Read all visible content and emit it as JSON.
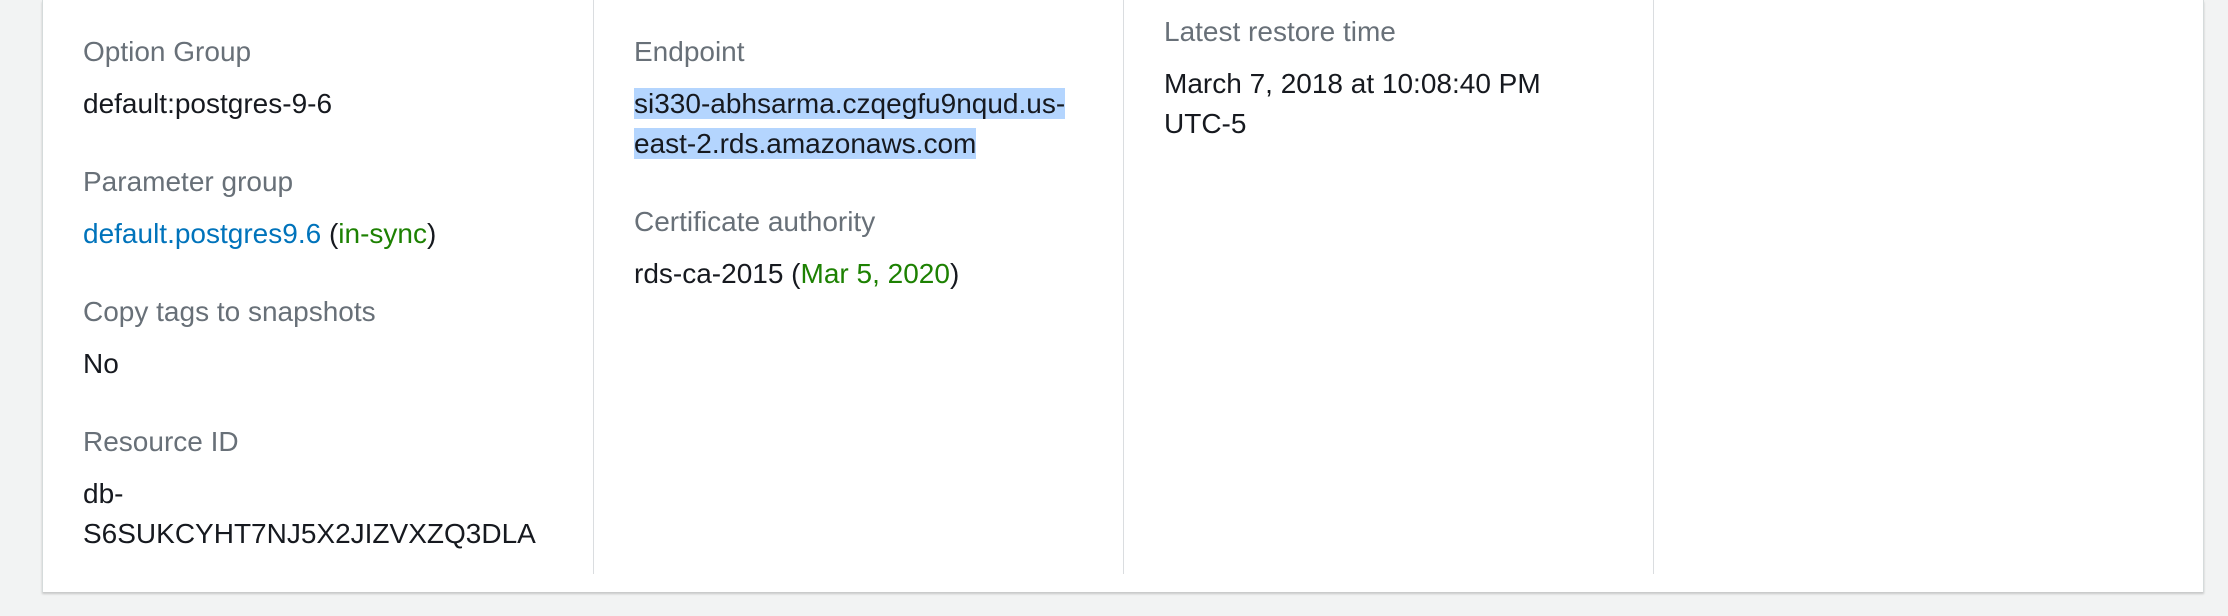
{
  "col1": {
    "option_group": {
      "label": "Option Group",
      "value": "default:postgres-9-6"
    },
    "parameter_group": {
      "label": "Parameter group",
      "link": "default.postgres9.6",
      "open": "(",
      "status": "in-sync",
      "close": ")"
    },
    "copy_tags": {
      "label": "Copy tags to snapshots",
      "value": "No"
    },
    "resource_id": {
      "label": "Resource ID",
      "line1": "db-",
      "line2": "S6SUKCYHT7NJ5X2JIZVXZQ3DLA"
    }
  },
  "col2": {
    "endpoint": {
      "label": "Endpoint",
      "line1": "si330-abhsarma.czqegfu9nqud.us-",
      "line2": "east-2.rds.amazonaws.com"
    },
    "cert": {
      "label": "Certificate authority",
      "value": "rds-ca-2015",
      "open": " (",
      "date": "Mar 5, 2020",
      "close": ")"
    }
  },
  "col3": {
    "restore": {
      "label": "Latest restore time",
      "line1": "March 7, 2018 at 10:08:40 PM",
      "line2": "UTC-5"
    }
  },
  "colors": {
    "link": "#0073bb",
    "status_ok": "#1d8102",
    "selection": "#b4d5fe"
  }
}
